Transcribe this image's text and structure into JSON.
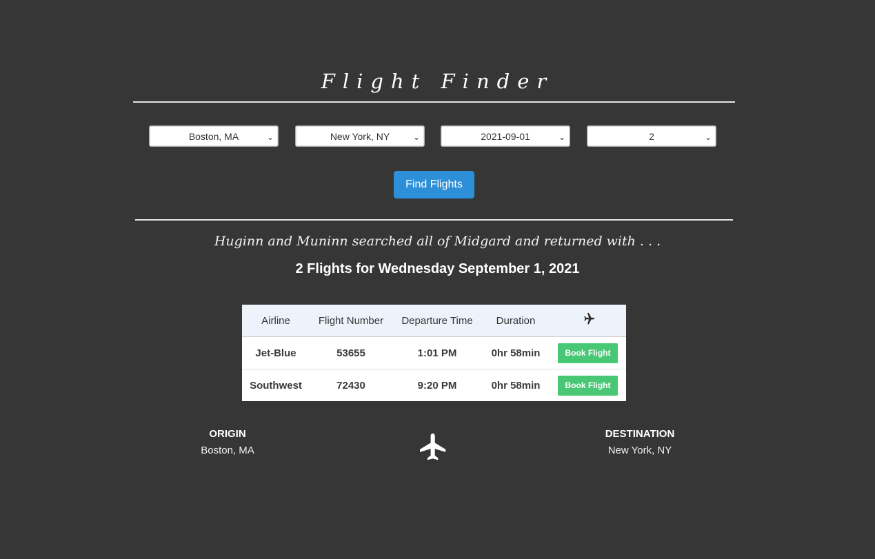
{
  "app": {
    "title": "Flight Finder"
  },
  "search": {
    "origin": "Boston, MA",
    "destination": "New York, NY",
    "date": "2021-09-01",
    "passengers": "2",
    "submit_label": "Find Flights"
  },
  "results": {
    "subtitle": "Huginn and Muninn searched all of Midgard and returned with . . .",
    "count_text": "2 Flights for Wednesday September 1, 2021",
    "columns": [
      "Airline",
      "Flight Number",
      "Departure Time",
      "Duration"
    ],
    "column_icon": "airplane-icon",
    "flights": [
      {
        "airline": "Jet-Blue",
        "flight_number": "53655",
        "departure": "1:01 PM",
        "duration": "0hr 58min",
        "action": "Book Flight"
      },
      {
        "airline": "Southwest",
        "flight_number": "72430",
        "departure": "9:20 PM",
        "duration": "0hr 58min",
        "action": "Book Flight"
      }
    ]
  },
  "route": {
    "origin_label": "ORIGIN",
    "origin_city": "Boston, MA",
    "destination_label": "DESTINATION",
    "destination_city": "New York, NY",
    "icon": "airplane-icon"
  },
  "colors": {
    "background": "#363636",
    "primary_button": "#2d8fd8",
    "book_button": "#48c774",
    "table_header": "#edf3fa"
  }
}
